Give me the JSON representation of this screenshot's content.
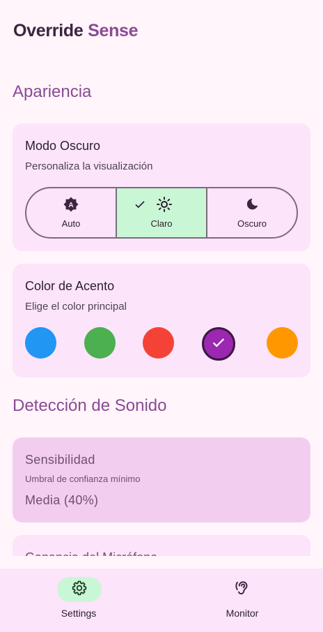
{
  "app": {
    "title_main": "Override",
    "title_accent": "Sense"
  },
  "apariencia": {
    "header": "Apariencia"
  },
  "modo_oscuro": {
    "title": "Modo Oscuro",
    "subtitle": "Personaliza la visualización",
    "options": [
      {
        "label": "Auto",
        "icon": "brightness-auto-icon",
        "selected": false
      },
      {
        "label": "Claro",
        "icon": "sun-icon",
        "selected": true
      },
      {
        "label": "Oscuro",
        "icon": "moon-icon",
        "selected": false
      }
    ]
  },
  "color_acento": {
    "title": "Color de Acento",
    "subtitle": "Elige el color principal",
    "colors": [
      "#2196f3",
      "#4caf50",
      "#f44336",
      "#9c27b0",
      "#ff9800"
    ],
    "selected_index": 3
  },
  "deteccion": {
    "header": "Detección de Sonido"
  },
  "sensibilidad": {
    "title": "Sensibilidad",
    "subtitle": "Umbral de confianza mínimo",
    "value": "Media (40%)"
  },
  "microfono": {
    "title": "Ganancia del Micrófono"
  },
  "nav": {
    "items": [
      {
        "label": "Settings",
        "icon": "gear-icon",
        "active": true
      },
      {
        "label": "Monitor",
        "icon": "hearing-icon",
        "active": false
      }
    ]
  },
  "colors": {
    "accent": "#8a4a96",
    "card": "#fce4fb",
    "selected_segment": "#c9f7d6",
    "nav_active_pill": "#c9f7d6"
  }
}
